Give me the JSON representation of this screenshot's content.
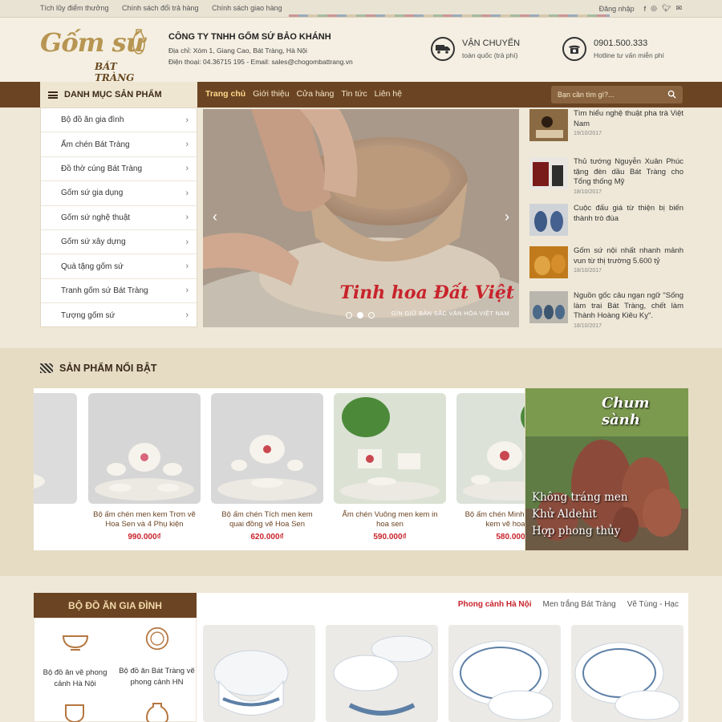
{
  "topbar": {
    "links": [
      "Tích lũy điểm thưởng",
      "Chính sách đổi trả hàng",
      "Chính sách giao hàng"
    ],
    "login": "Đăng nhập"
  },
  "header": {
    "logo_main": "Gốm sứ",
    "logo_sub": "BÁT TRÀNG",
    "company_name": "CÔNG TY TNHH GỐM SỨ BẢO KHÁNH",
    "address": "Địa chỉ: Xóm 1, Giang Cao, Bát Tràng, Hà Nội",
    "contact": "Điện thoại: 04.36715 195 - Email: sales@chogombattrang.vn",
    "shipping_title": "VẬN CHUYỂN",
    "shipping_sub": "toàn quốc (trả phí)",
    "hotline_number": "0901.500.333",
    "hotline_sub": "Hotline tư vấn miễn phí"
  },
  "nav": {
    "category_button": "DANH MỤC SẢN PHẨM",
    "links": [
      "Trang chủ",
      "Giới thiệu",
      "Cửa hàng",
      "Tin tức",
      "Liên hệ"
    ],
    "search_placeholder": "Bạn cần tìm gì?..."
  },
  "categories": [
    "Bộ đồ ăn gia đình",
    "Ấm chén Bát Tràng",
    "Đồ thờ cúng Bát Tràng",
    "Gốm sứ gia dụng",
    "Gốm sứ nghệ thuật",
    "Gốm sứ xây dựng",
    "Quà tặng gốm sứ",
    "Tranh gốm sứ Bát Tràng",
    "Tượng gốm sứ"
  ],
  "slider": {
    "caption": "Tinh hoa Đất Việt",
    "subcaption": "GÌN GIỮ BẢN SẮC VĂN HÓA VIỆT NAM",
    "prev": "‹",
    "next": "›"
  },
  "news": [
    {
      "title": "Tìm hiểu nghệ thuật pha trà Việt Nam",
      "date": "19/10/2017"
    },
    {
      "title": "Thủ tướng Nguyễn Xuân Phúc tặng đèn dầu Bát Tràng cho Tổng thống Mỹ",
      "date": "18/10/2017"
    },
    {
      "title": "Cuộc đấu giá từ thiện bị biến thành trò đùa",
      "date": "18/10/2017"
    },
    {
      "title": "Gốm sứ nội nhất nhanh mảnh vun từ thị trường 5.600 tỷ",
      "date": "18/10/2017"
    },
    {
      "title": "Nguồn gốc câu ngạn ngữ \"Sống làm trai Bát Tràng, chết làm Thành Hoàng Kiêu Kỵ\".",
      "date": "18/10/2017"
    }
  ],
  "featured": {
    "title": "SẢN PHẨM NỔI BẬT",
    "products": [
      {
        "name": "Bộ ấm chén men kem Trơn vẽ Hoa Sen và 4 Phụ kiện",
        "price": "990.000₫"
      },
      {
        "name": "Bộ ấm chén Tích men kem quai đồng vẽ Hoa Sen",
        "price": "620.000₫"
      },
      {
        "name": "Ấm chén Vuông men kem in hoa sen",
        "price": "590.000₫"
      },
      {
        "name": "Bộ ấm chén Minh Long men kem vẽ hoa sen",
        "price": "580.000₫"
      }
    ],
    "promo": {
      "title": "Chum sành",
      "lines": [
        "Không tráng men",
        "Khử Aldehit",
        "Hợp phong thủy"
      ]
    }
  },
  "section2": {
    "title": "BỘ ĐỒ ĂN GIA ĐÌNH",
    "tabs": [
      "Phong cảnh Hà Nội",
      "Men trắng Bát Tràng",
      "Vẽ Tùng - Hạc"
    ],
    "subcats": [
      "Bộ đồ ăn vẽ phong cảnh Hà Nội",
      "Bộ đồ ăn Bát Tràng vẽ phong cảnh HN"
    ]
  },
  "colors": {
    "brown": "#6b4423",
    "gold": "#b79552",
    "red": "#c8232c"
  }
}
